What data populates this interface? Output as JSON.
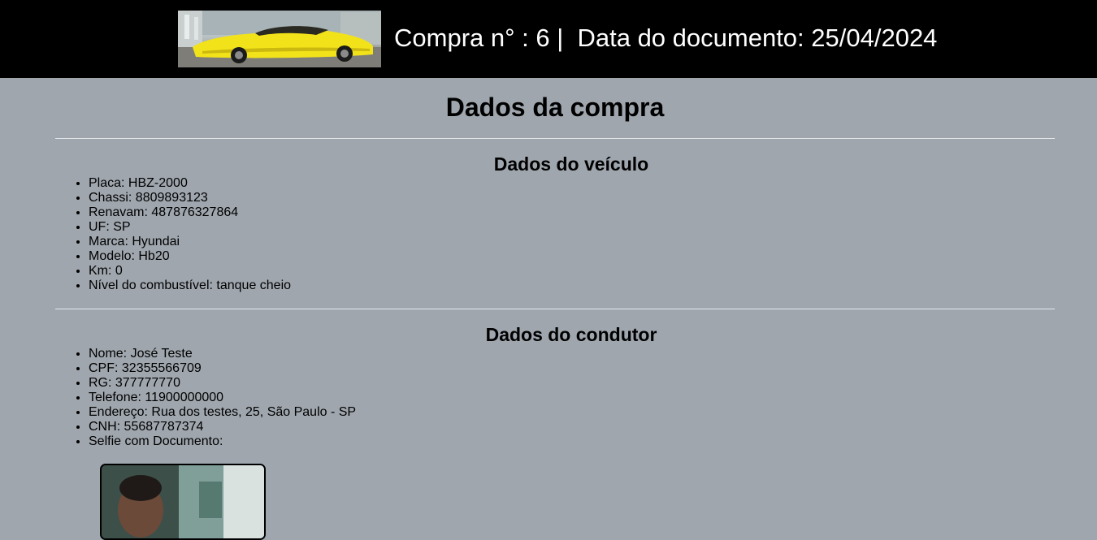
{
  "header": {
    "title": "Compra n° : 6 |  Data do documento: 25/04/2024",
    "logo_icon": "yellow-sports-car-image"
  },
  "page_title": "Dados da compra",
  "vehicle": {
    "heading": "Dados do veículo",
    "items": [
      "Placa: HBZ-2000",
      "Chassi: 8809893123",
      "Renavam: 487876327864",
      "UF: SP",
      "Marca: Hyundai",
      "Modelo: Hb20",
      "Km: 0",
      "Nível do combustível: tanque cheio"
    ]
  },
  "driver": {
    "heading": "Dados do condutor",
    "items": [
      "Nome: José Teste",
      "CPF: 32355566709",
      "RG: 377777770",
      "Telefone: 11900000000",
      "Endereço: Rua dos testes, 25, São Paulo - SP",
      "CNH: 55687787374",
      "Selfie com Documento:"
    ],
    "selfie_icon": "selfie-photo"
  },
  "colors": {
    "header_bg": "#000000",
    "page_bg": "#9fa6ae",
    "header_text": "#ffffff",
    "divider": "#e5e8ea"
  }
}
